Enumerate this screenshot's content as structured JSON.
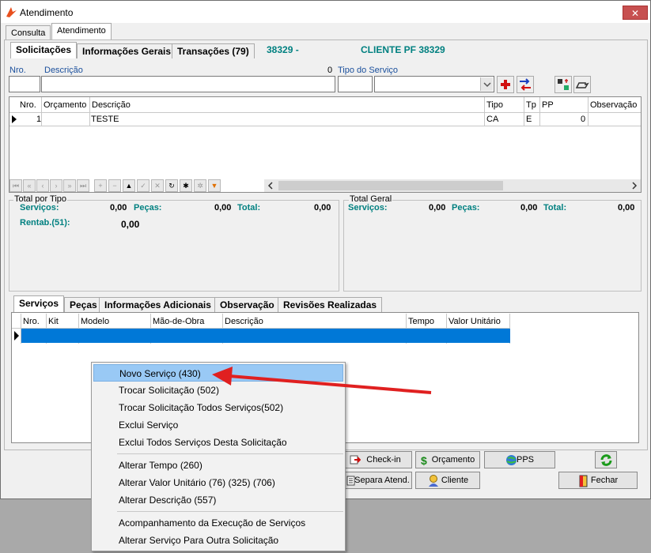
{
  "window": {
    "title": "Atendimento",
    "close": "✕"
  },
  "top_tabs": [
    "Consulta",
    "Atendimento"
  ],
  "inner_tabs": [
    "Solicitações",
    "Informações Gerais",
    "Transações (79)"
  ],
  "header_info": {
    "code": "38329 -",
    "client": "CLIENTE PF 38329"
  },
  "form": {
    "nro_label": "Nro.",
    "desc_label": "Descrição",
    "count": "0",
    "tipo_label": "Tipo do Serviço"
  },
  "solic_grid": {
    "columns": [
      "Nro.",
      "Orçamento",
      "Descrição",
      "Tipo",
      "Tp",
      "PP",
      "Observação"
    ],
    "row": {
      "nro": "1",
      "orcamento": "",
      "descricao": "TESTE",
      "tipo": "CA",
      "tp": "E",
      "pp": "0",
      "obs": ""
    }
  },
  "totals_tipo": {
    "title": "Total por Tipo",
    "servicos_label": "Serviços:",
    "servicos": "0,00",
    "pecas_label": "Peças:",
    "pecas": "0,00",
    "total_label": "Total:",
    "total": "0,00",
    "rentab_label": "Rentab.(51):",
    "rentab": "0,00"
  },
  "totals_geral": {
    "title": "Total Geral",
    "servicos_label": "Serviços:",
    "servicos": "0,00",
    "pecas_label": "Peças:",
    "pecas": "0,00",
    "total_label": "Total:",
    "total": "0,00"
  },
  "sub_tabs": [
    "Serviços",
    "Peças",
    "Informações Adicionais",
    "Observação",
    "Revisões Realizadas"
  ],
  "serv_grid": {
    "columns": [
      "Nro.",
      "Kit",
      "Modelo",
      "Mão-de-Obra",
      "Descrição",
      "Tempo",
      "Valor Unitário"
    ]
  },
  "buttons": {
    "checkin": "Check-in",
    "orcamento": "Orçamento",
    "pps": "PPS",
    "separa": "Separa Atend.",
    "cliente": "Cliente",
    "fechar": "Fechar"
  },
  "context_menu": [
    "Novo Serviço (430)",
    "Trocar Solicitação (502)",
    "Trocar Solicitação Todos Serviços(502)",
    "Exclui Serviço",
    "Exclui Todos Serviços Desta Solicitação",
    "Alterar Tempo (260)",
    "Alterar Valor Unitário (76) (325) (706)",
    "Alterar Descrição (557)",
    "Acompanhamento da Execução de Serviços",
    "Alterar Serviço Para Outra Solicitação"
  ],
  "colors": {
    "teal": "#008080",
    "selection": "#0078d7",
    "menu_highlight": "#99c9f5",
    "arrow": "#e02020"
  }
}
